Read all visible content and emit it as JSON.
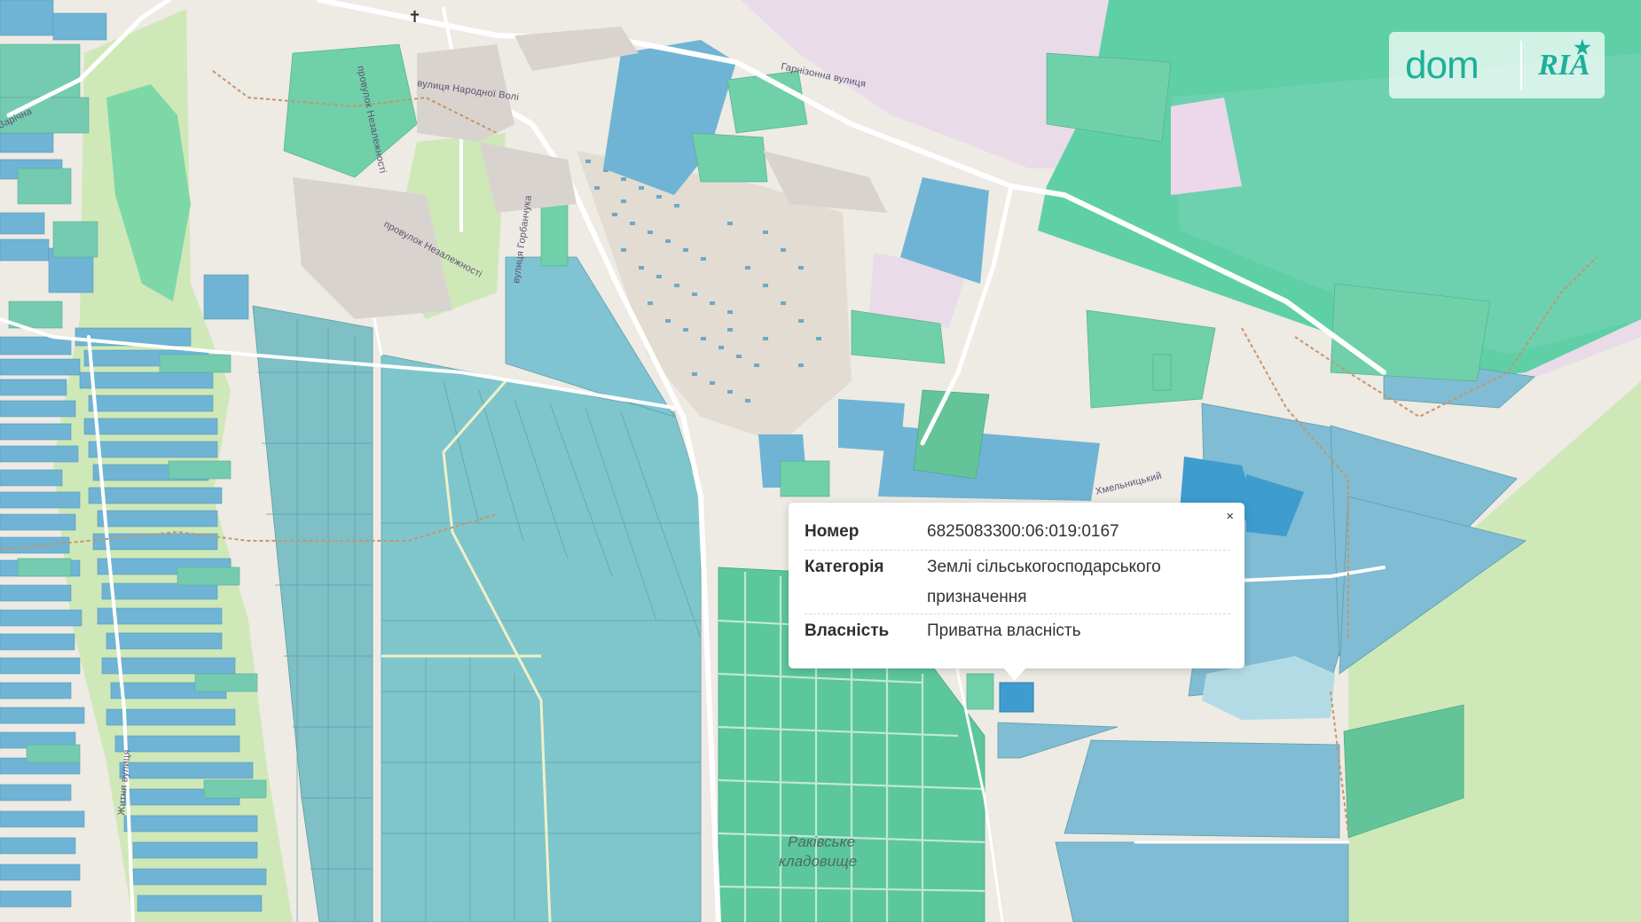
{
  "brand": {
    "logo_primary": "dom",
    "logo_secondary": "RIA",
    "accent_color": "#1db09a"
  },
  "map": {
    "labels": {
      "street_1": "вулиця Народної Волі",
      "street_2": "Гарнізонна вулиця",
      "street_3": "провулок Незалежності",
      "street_4": "провулок Незалежності",
      "street_5": "вулиця Горбанчука",
      "street_6": "Хмельницький",
      "street_7": "Житня вулиця",
      "street_8": "Зарічна",
      "cemetery_line1": "Раківське",
      "cemetery_line2": "кладовище"
    },
    "layer_colors": {
      "residential": "#6fb4d4",
      "agricultural": "#7fcbc6",
      "industrial": "#79c7c9",
      "selected_parcel": "#3e9ccf",
      "green_zone": "#cfe8b8",
      "forest": "#5fcfa6",
      "military": "#eadbe8"
    }
  },
  "popup": {
    "close_label": "×",
    "rows": [
      {
        "key": "Номер",
        "value": "6825083300:06:019:0167"
      },
      {
        "key": "Категорія",
        "value_line1": "Землі сільськогосподарського",
        "value_line2": "призначення"
      },
      {
        "key": "Власність",
        "value": "Приватна власність"
      }
    ]
  }
}
